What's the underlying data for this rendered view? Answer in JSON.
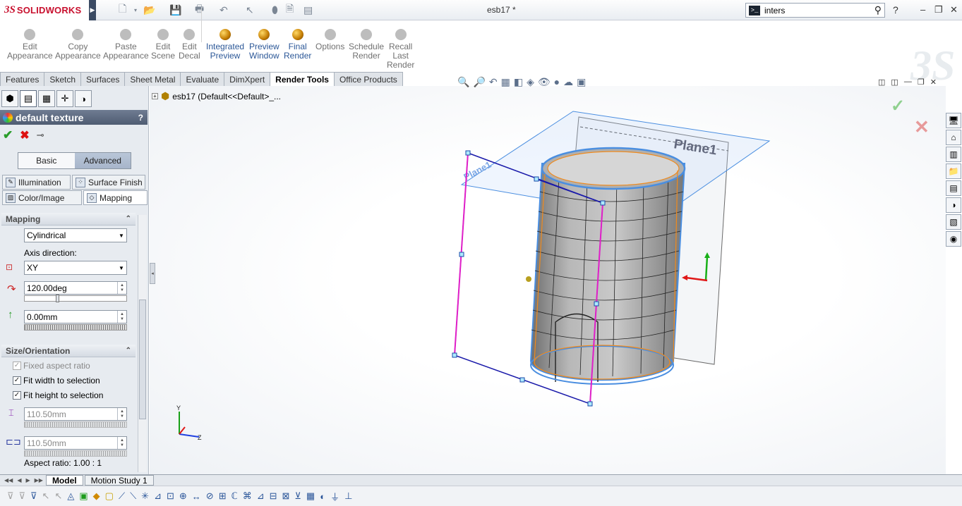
{
  "app": {
    "brand": "SOLIDWORKS",
    "brand_mark": "3S",
    "doc_title": "esb17 *"
  },
  "search": {
    "value": "inters",
    "term_icon": ">_"
  },
  "window_controls": {
    "help": "?",
    "minimize": "–",
    "restore": "❐",
    "close": "✕"
  },
  "ribbon": {
    "buttons": [
      {
        "label1": "Edit",
        "label2": "Appearance",
        "label3": ""
      },
      {
        "label1": "Copy",
        "label2": "Appearance",
        "label3": ""
      },
      {
        "label1": "Paste",
        "label2": "Appearance",
        "label3": ""
      },
      {
        "label1": "Edit",
        "label2": "Scene",
        "label3": ""
      },
      {
        "label1": "Edit",
        "label2": "Decal",
        "label3": ""
      },
      {
        "label1": "Integrated",
        "label2": "Preview",
        "label3": ""
      },
      {
        "label1": "Preview",
        "label2": "Window",
        "label3": ""
      },
      {
        "label1": "Final",
        "label2": "Render",
        "label3": ""
      },
      {
        "label1": "Options",
        "label2": "",
        "label3": ""
      },
      {
        "label1": "Schedule",
        "label2": "Render",
        "label3": ""
      },
      {
        "label1": "Recall",
        "label2": "Last",
        "label3": "Render"
      }
    ]
  },
  "command_tabs": [
    "Features",
    "Sketch",
    "Surfaces",
    "Sheet Metal",
    "Evaluate",
    "DimXpert",
    "Render Tools",
    "Office Products"
  ],
  "active_command_tab": "Render Tools",
  "tree": {
    "root": "esb17  (Default<<Default>_..."
  },
  "panel": {
    "title": "default texture",
    "help": "?",
    "modes": [
      "Basic",
      "Advanced"
    ],
    "active_mode": "Advanced",
    "tabs": [
      "Illumination",
      "Surface Finish",
      "Color/Image",
      "Mapping"
    ],
    "active_tab": "Mapping",
    "mapping": {
      "header": "Mapping",
      "type": "Cylindrical",
      "axis_label": "Axis direction:",
      "axis": "XY",
      "rotation": "120.00deg",
      "offset": "0.00mm"
    },
    "size": {
      "header": "Size/Orientation",
      "fixed_aspect": "Fixed aspect ratio",
      "fit_width": "Fit width to selection",
      "fit_height": "Fit height to selection",
      "width": "110.50mm",
      "height": "110.50mm",
      "aspect_ratio": "Aspect ratio: 1.00 : 1"
    }
  },
  "viewport": {
    "plane_label": "Plane1",
    "plane_label_2": "Plane1",
    "triad_y": "Y",
    "triad_z": "Z"
  },
  "bottom_tabs": [
    "Model",
    "Motion Study 1"
  ],
  "active_bottom_tab": "Model",
  "icons": {
    "ok": "check-icon",
    "cancel": "x-icon",
    "pin": "pushpin-icon"
  },
  "colors": {
    "accent": "#2b5797",
    "ok": "#2a9d2a",
    "cancel": "#dd1111",
    "plane": "#4a8ee0",
    "sketch_magenta": "#e020c8",
    "sketch_blue": "#1a1aaa",
    "cylinder_edge": "#f08a1c"
  }
}
